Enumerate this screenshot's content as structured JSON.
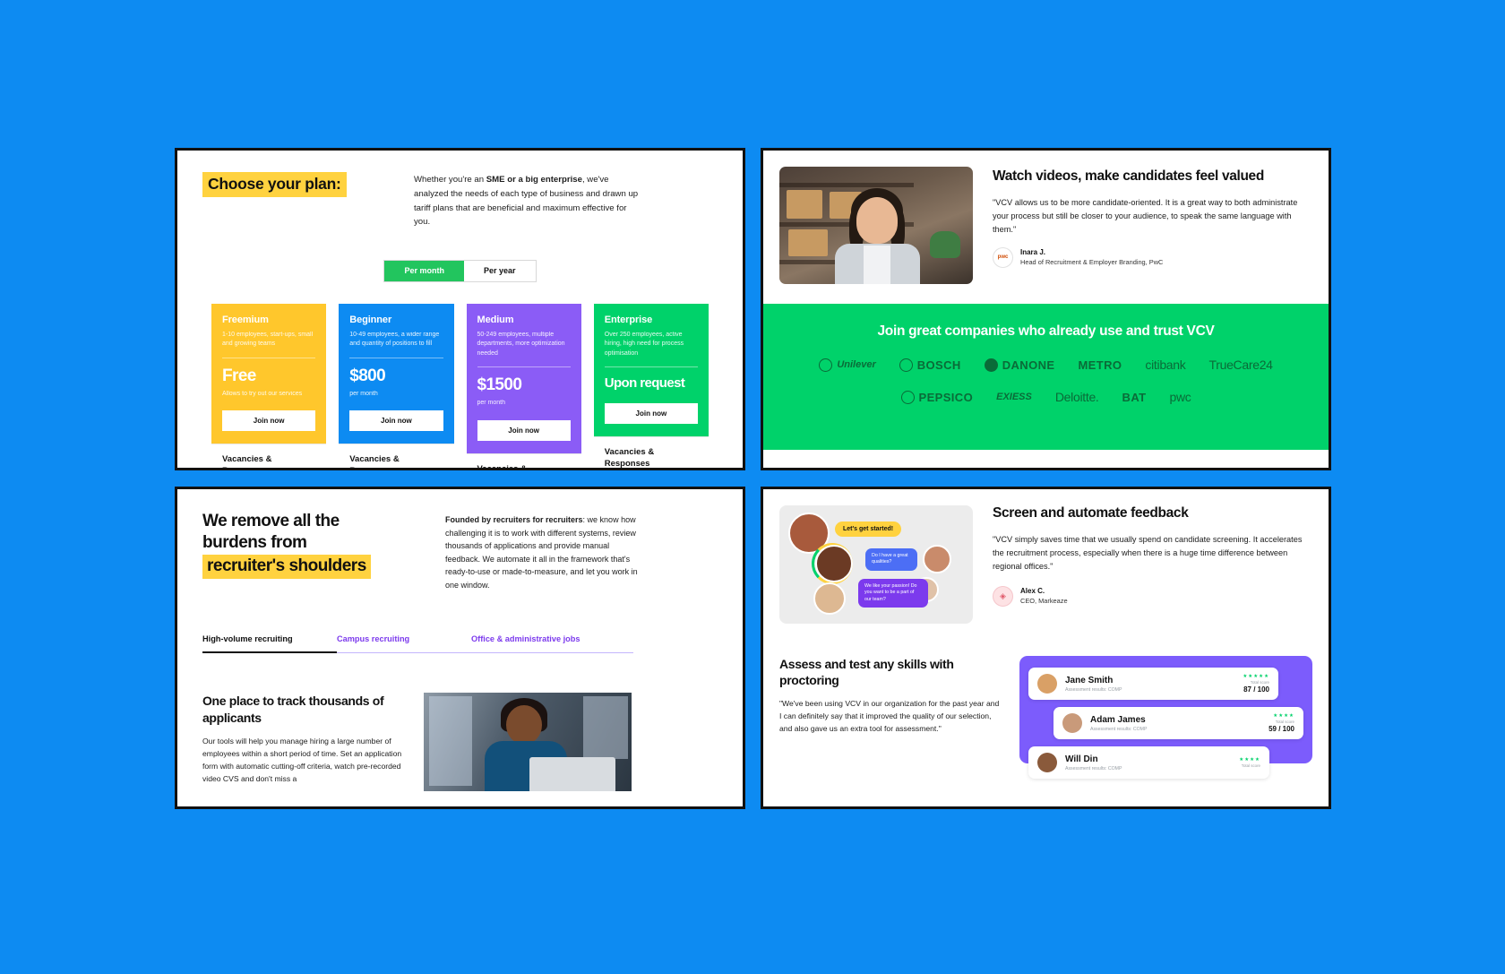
{
  "page": {
    "background_color": "#0d8bf2"
  },
  "pricing": {
    "title": "Choose your plan:",
    "description_lead": "Whether you're an ",
    "description_bold": "SME or a big enterprise",
    "description_rest": ", we've analyzed the needs of each type of business and drawn up tariff plans that are beneficial and maximum effective for you.",
    "toggle": {
      "monthly": "Per month",
      "yearly": "Per year",
      "selected": "Per month"
    },
    "footer_label": "Vacancies & Responses",
    "plans": [
      {
        "name": "Freemium",
        "audience": "1-10 employees, start-ups, small and growing teams",
        "price": "Free",
        "per": "Allows to try out our services",
        "cta": "Join now",
        "color": "#ffc72c"
      },
      {
        "name": "Beginner",
        "audience": "10-49 employees, a wider range and quantity of positions to fill",
        "price": "$800",
        "per": "per month",
        "cta": "Join now",
        "color": "#0d8bf2"
      },
      {
        "name": "Medium",
        "audience": "50-249 employees, multiple departments, more optimization needed",
        "price": "$1500",
        "per": "per month",
        "cta": "Join now",
        "color": "#8b5cf6"
      },
      {
        "name": "Enterprise",
        "audience": "Over 250 employees, active hiring, high need for process optimisation",
        "price": "Upon request",
        "per": "",
        "cta": "Join now",
        "color": "#00d26a"
      }
    ]
  },
  "video_panel": {
    "title": "Watch videos, make candidates feel valued",
    "quote": "\"VCV allows us to be more candidate-oriented. It is a great way to both administrate your process but still be closer to your audience, to speak the same language with them.\"",
    "author_name": "Inara J.",
    "author_role": "Head of Recruitment & Employer Branding, PwC",
    "author_avatar_label": "pwc",
    "band": {
      "title": "Join great companies who already use and trust VCV",
      "background_color": "#00d26a",
      "logos_row1": [
        "Unilever",
        "BOSCH",
        "DANONE",
        "METRO",
        "citibank",
        "TrueCare24"
      ],
      "logos_row2": [
        "PEPSICO",
        "EXIESS",
        "Deloitte.",
        "BAT",
        "pwc"
      ]
    }
  },
  "burdens_panel": {
    "title_line1": "We remove all the",
    "title_line2": "burdens from",
    "title_line3": "recruiter's shoulders",
    "description_bold": "Founded by recruiters for recruiters",
    "description_rest": ": we know how challenging it is to work with different systems, review thousands of applications and provide manual feedback. We automate it all in the framework that's ready-to-use or made-to-measure, and let you work in one window.",
    "tabs": [
      {
        "label": "High-volume recruiting",
        "active": true
      },
      {
        "label": "Campus recruiting",
        "active": false
      },
      {
        "label": "Office & administrative jobs",
        "active": false
      }
    ],
    "track_title": "One place to track thousands of applicants",
    "track_description": "Our tools will help you manage hiring a large number of employees within a short period of time. Set an application form with automatic cutting-off criteria, watch pre-recorded video CVS and don't miss a"
  },
  "screen_panel": {
    "title": "Screen and automate feedback",
    "quote": "\"VCV simply saves time that we usually spend on candidate screening. It accelerates the recruitment process, especially when there is a huge time difference between regional offices.\"",
    "author_name": "Alex C.",
    "author_role": "CEO, Markeaze",
    "chat": {
      "bubble_yellow": "Let's get started!",
      "bubble_blue": "Do I have a great qualities?",
      "bubble_purple": "We like your passion! Do you want to be a part of our team?"
    },
    "assess_title": "Assess and test any skills with proctoring",
    "assess_description": "\"We've been using VCV in our organization for the past year and I can definitely say that it improved the quality of our selection, and also gave us an extra tool for assessment.\"",
    "candidates": [
      {
        "name": "Jane Smith",
        "sub": "Assessment results: COMP",
        "stars": "★★★★★",
        "score_label": "Total score",
        "score": "87 / 100"
      },
      {
        "name": "Adam James",
        "sub": "Assessment results: COMP",
        "stars": "★★★★",
        "score_label": "Total score",
        "score": "59 / 100"
      },
      {
        "name": "Will Din",
        "sub": "Assessment results: COMP",
        "stars": "★★★★",
        "score_label": "Total score",
        "score": ""
      }
    ]
  }
}
